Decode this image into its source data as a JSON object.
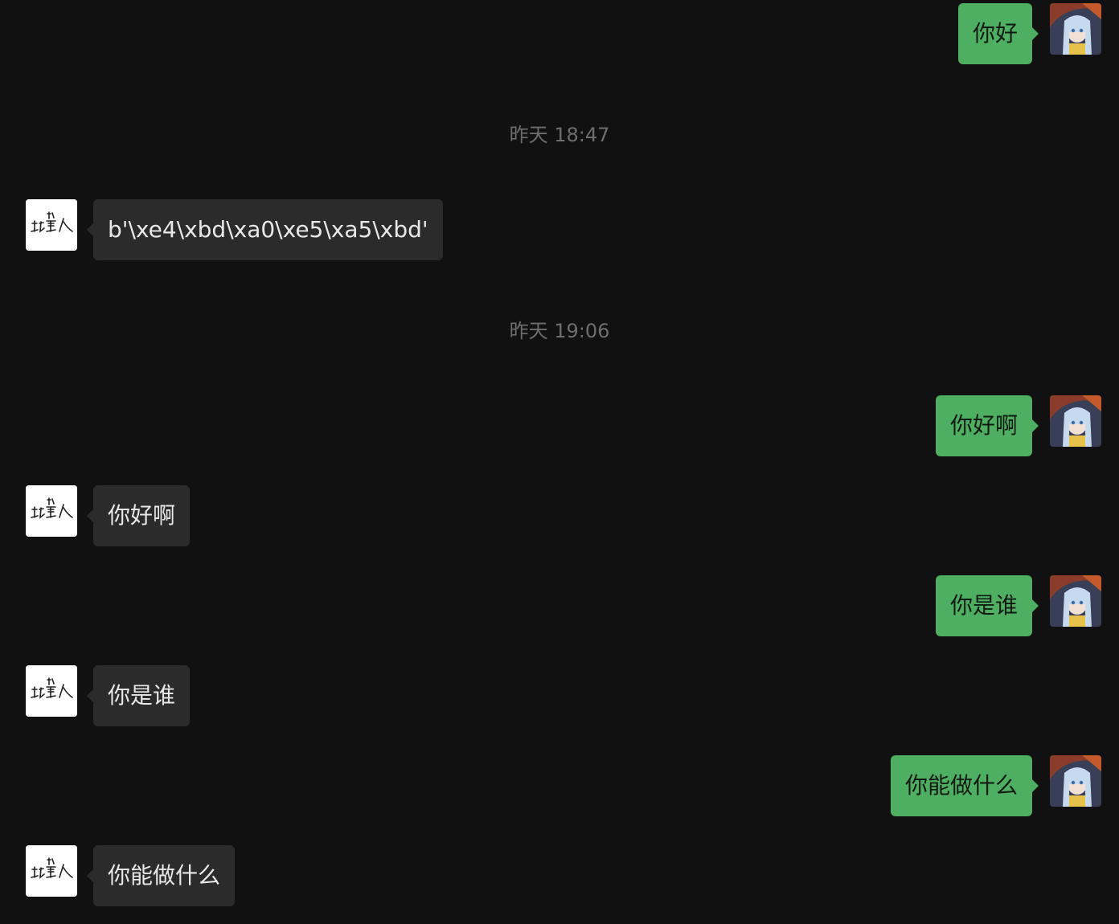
{
  "messages": [
    {
      "type": "message",
      "side": "me",
      "text": "你好"
    },
    {
      "type": "timestamp",
      "text": "昨天 18:47"
    },
    {
      "type": "message",
      "side": "bot",
      "text": "b'\\xe4\\xbd\\xa0\\xe5\\xa5\\xbd'"
    },
    {
      "type": "timestamp",
      "text": "昨天 19:06"
    },
    {
      "type": "message",
      "side": "me",
      "text": "你好啊"
    },
    {
      "type": "message",
      "side": "bot",
      "text": "你好啊"
    },
    {
      "type": "message",
      "side": "me",
      "text": "你是谁"
    },
    {
      "type": "message",
      "side": "bot",
      "text": "你是谁"
    },
    {
      "type": "message",
      "side": "me",
      "text": "你能做什么"
    },
    {
      "type": "message",
      "side": "bot",
      "text": "你能做什么"
    }
  ],
  "colors": {
    "background": "#111111",
    "my_bubble": "#4eae62",
    "bot_bubble": "#2b2b2b",
    "timestamp_text": "#6e6e6e"
  },
  "icons": {
    "my_avatar": "anime-girl-avatar-icon",
    "bot_avatar": "calligraphy-logo-avatar-icon"
  }
}
